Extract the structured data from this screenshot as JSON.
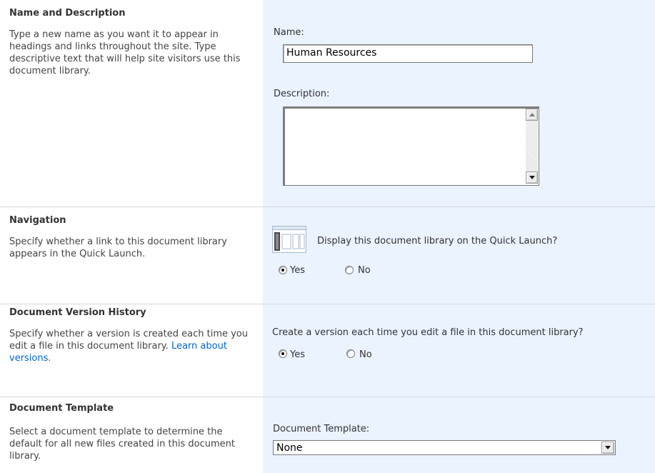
{
  "sections": {
    "name_description": {
      "heading": "Name and Description",
      "description": "Type a new name as you want it to appear in headings and links throughout the site. Type descriptive text that will help site visitors use this document library.",
      "name_label": "Name:",
      "name_value": "Human Resources",
      "description_label": "Description:",
      "description_value": ""
    },
    "navigation": {
      "heading": "Navigation",
      "description": "Specify whether a link to this document library appears in the Quick Launch.",
      "question": "Display this document library on the Quick Launch?",
      "icon": "quick-launch-icon",
      "yes_label": "Yes",
      "no_label": "No",
      "selected": "Yes"
    },
    "version_history": {
      "heading": "Document Version History",
      "description": "Specify whether a version is created each time you edit a file in this document library.",
      "learn_link": "Learn about versions.",
      "question": "Create a version each time you edit a file in this document library?",
      "yes_label": "Yes",
      "no_label": "No",
      "selected": "Yes"
    },
    "template": {
      "heading": "Document Template",
      "description": "Select a document template to determine the default for all new files created in this document library.",
      "label": "Document Template:",
      "selected_value": "None"
    }
  },
  "colors": {
    "control_column_bg": "#ebf3ff",
    "separator": "#d2d8e0",
    "link": "#0066cc"
  }
}
